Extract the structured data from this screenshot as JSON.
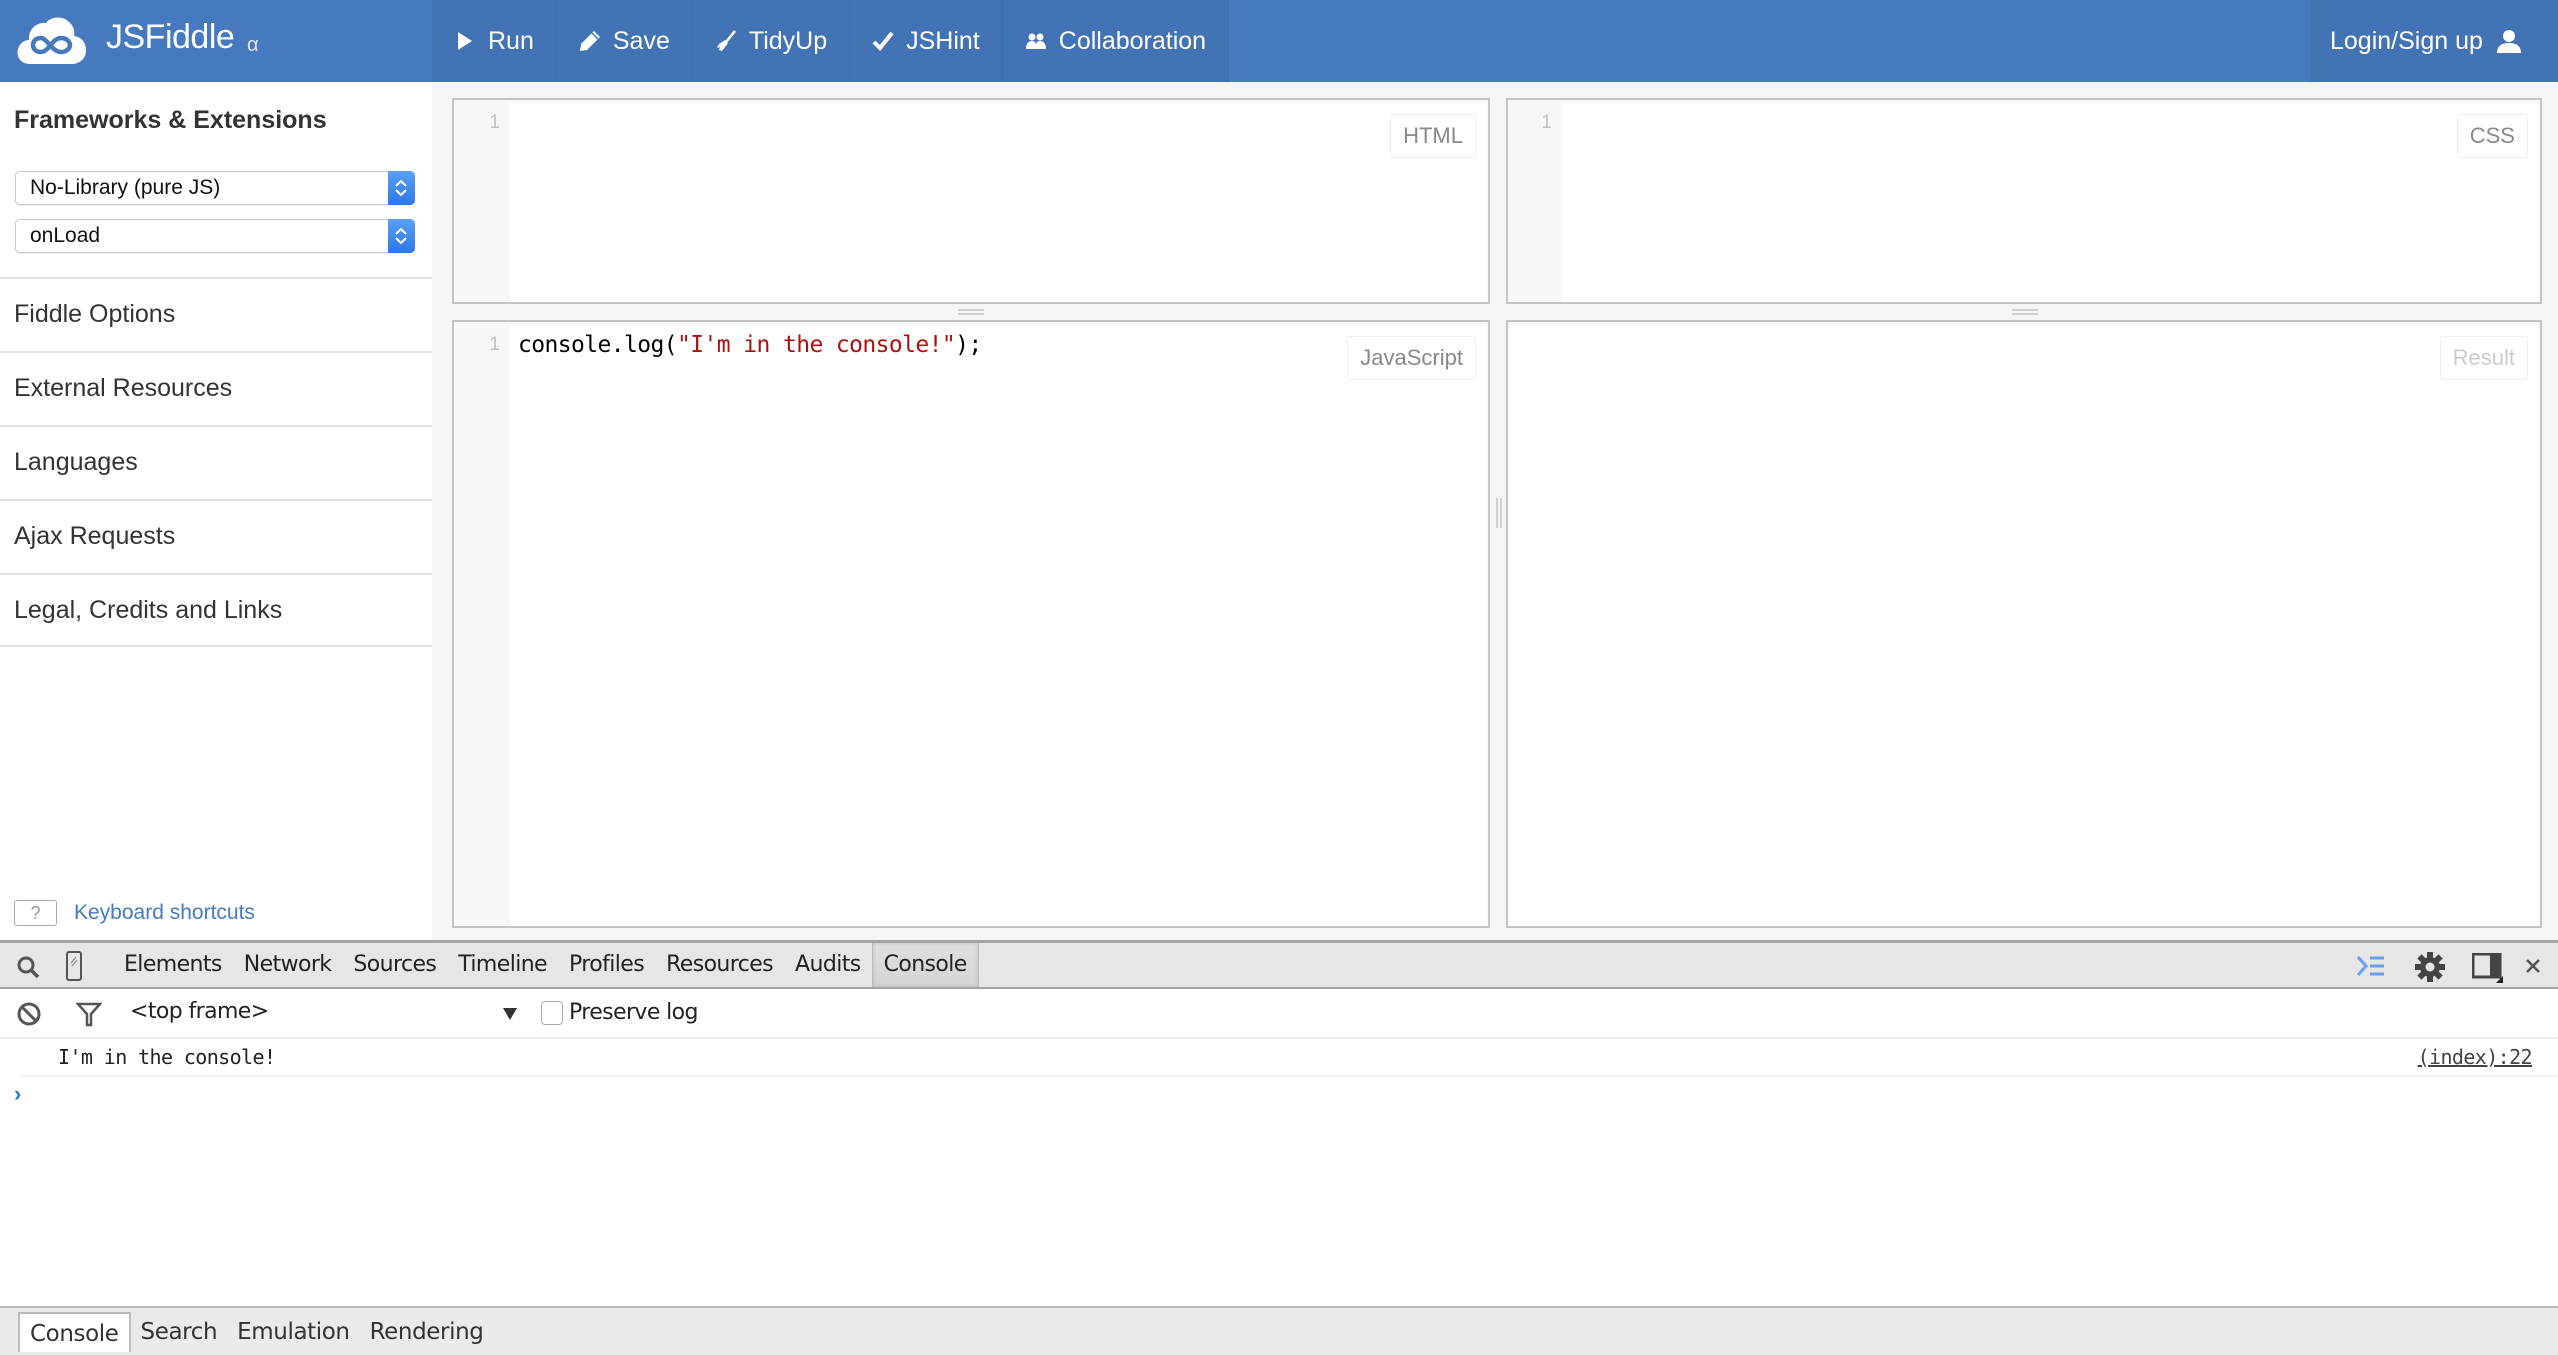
{
  "topbar": {
    "brand": "JSFiddle",
    "brand_badge": "α",
    "nav": [
      {
        "label": "Run",
        "icon": "play-icon"
      },
      {
        "label": "Save",
        "icon": "pencil-icon"
      },
      {
        "label": "TidyUp",
        "icon": "broom-icon"
      },
      {
        "label": "JSHint",
        "icon": "check-icon"
      },
      {
        "label": "Collaboration",
        "icon": "users-icon"
      }
    ],
    "login_label": "Login/Sign up",
    "colors": {
      "bar": "#4679bd",
      "nav": "#4273b5"
    }
  },
  "sidebar": {
    "title": "Frameworks & Extensions",
    "library_select": "No-Library (pure JS)",
    "load_select": "onLoad",
    "items": [
      {
        "label": "Fiddle Options"
      },
      {
        "label": "External Resources"
      },
      {
        "label": "Languages"
      },
      {
        "label": "Ajax Requests"
      },
      {
        "label": "Legal, Credits and Links"
      }
    ],
    "keyboard_key": "?",
    "keyboard_label": "Keyboard shortcuts"
  },
  "editors": {
    "html": {
      "label": "HTML",
      "line": "1"
    },
    "css": {
      "label": "CSS",
      "line": "1"
    },
    "js": {
      "label": "JavaScript",
      "line": "1",
      "code_prefix": "console.log(",
      "code_string": "\"I'm in the console!\"",
      "code_suffix": ");"
    },
    "result": {
      "label": "Result"
    }
  },
  "devtools": {
    "tabs": [
      "Elements",
      "Network",
      "Sources",
      "Timeline",
      "Profiles",
      "Resources",
      "Audits",
      "Console"
    ],
    "active_tab": "Console",
    "frame": "<top frame>",
    "preserve_log_label": "Preserve log",
    "preserve_log_checked": false,
    "log": [
      {
        "message": "I'm in the console!",
        "source": "(index):22"
      }
    ],
    "prompt": "›",
    "drawer_tabs": [
      "Console",
      "Search",
      "Emulation",
      "Rendering"
    ],
    "drawer_active": "Console"
  }
}
